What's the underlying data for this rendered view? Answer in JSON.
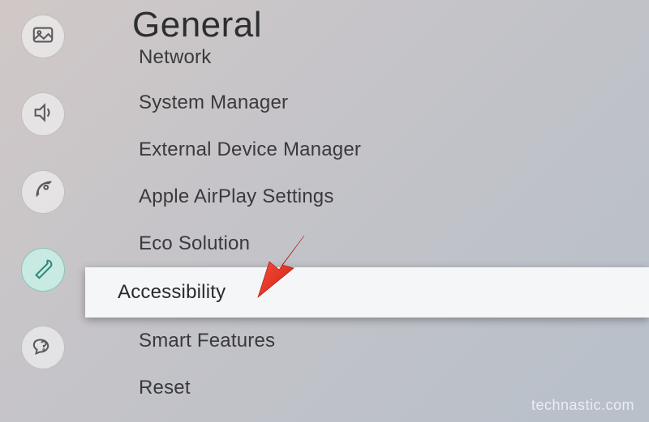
{
  "page_title": "General",
  "sidebar": {
    "items": [
      {
        "name": "picture"
      },
      {
        "name": "sound"
      },
      {
        "name": "broadcast"
      },
      {
        "name": "general",
        "active": true
      },
      {
        "name": "support"
      }
    ]
  },
  "menu": {
    "items": [
      {
        "label": "Network",
        "partial": true
      },
      {
        "label": "System Manager"
      },
      {
        "label": "External Device Manager"
      },
      {
        "label": "Apple AirPlay Settings"
      },
      {
        "label": "Eco Solution"
      },
      {
        "label": "Accessibility",
        "selected": true
      },
      {
        "label": "Smart Features"
      },
      {
        "label": "Reset"
      }
    ]
  },
  "watermark": "technastic.com"
}
